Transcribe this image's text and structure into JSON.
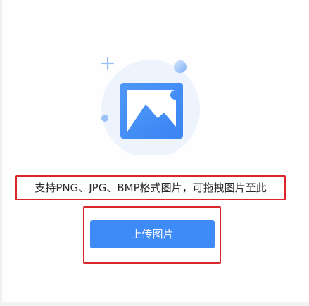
{
  "upload": {
    "hint_text": "支持PNG、JPG、BMP格式图片，可拖拽图片至此",
    "button_label": "上传图片"
  },
  "icons": {
    "illustration": "image-placeholder-icon"
  },
  "colors": {
    "accent": "#3e8bf7",
    "illustration_circle": "#eef4fd",
    "annotation_outline": "#d9262c"
  }
}
